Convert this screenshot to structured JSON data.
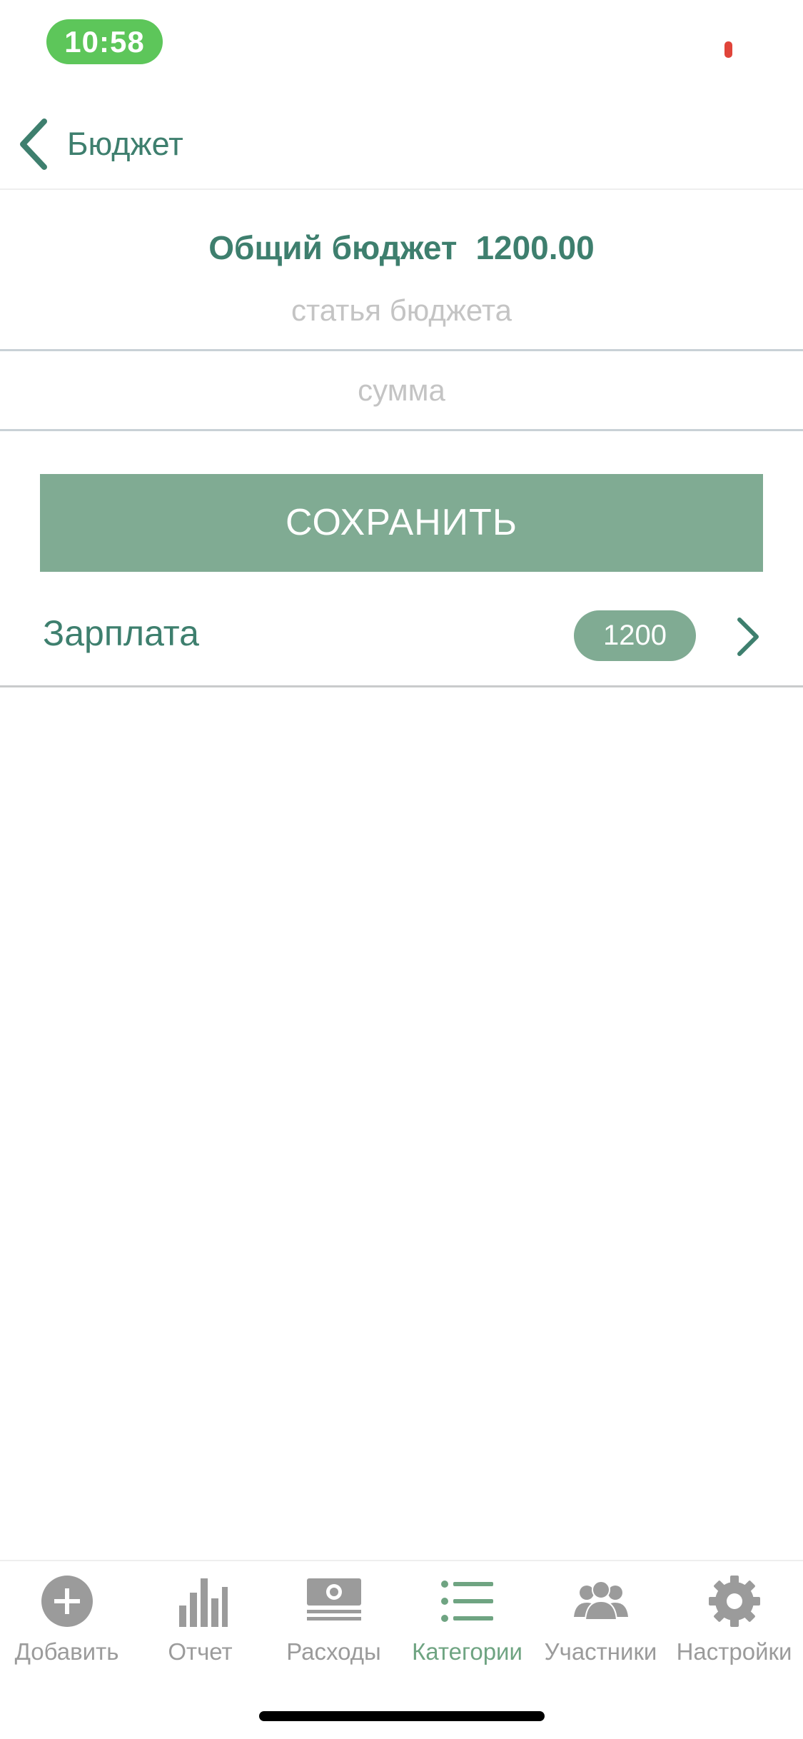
{
  "status_bar": {
    "time": "10:58"
  },
  "nav": {
    "back_label": "Бюджет"
  },
  "budget": {
    "title": "Общий бюджет",
    "total": "1200.00",
    "item_placeholder": "статья бюджета",
    "sum_placeholder": "сумма",
    "save_label": "СОХРАНИТЬ"
  },
  "items": [
    {
      "label": "Зарплата",
      "amount": "1200"
    }
  ],
  "tabs": [
    {
      "label": "Добавить",
      "icon": "add-circle-icon"
    },
    {
      "label": "Отчет",
      "icon": "bar-chart-icon"
    },
    {
      "label": "Расходы",
      "icon": "money-icon"
    },
    {
      "label": "Категории",
      "icon": "list-icon",
      "active": true
    },
    {
      "label": "Участники",
      "icon": "users-icon"
    },
    {
      "label": "Настройки",
      "icon": "gear-icon"
    }
  ],
  "colors": {
    "accent": "#3e7f6e",
    "button": "#80ab93",
    "active_tab": "#6fa482",
    "inactive_tab": "#9b9b9b",
    "time_pill": "#5dc65a"
  }
}
